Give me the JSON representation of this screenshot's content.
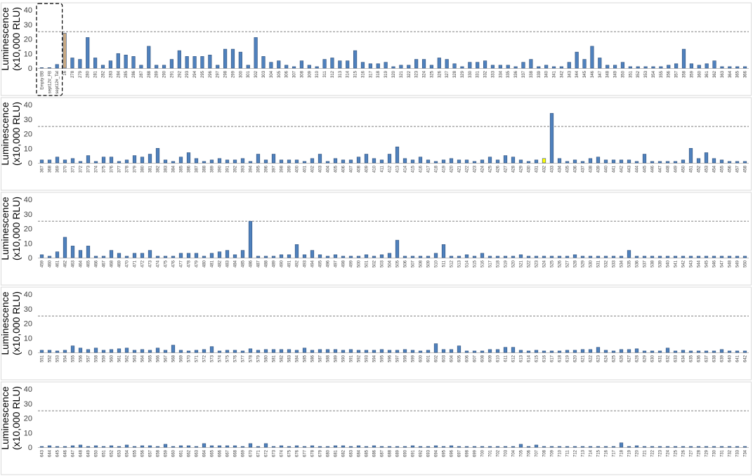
{
  "chart_data": [
    {
      "type": "bar",
      "ylabel": "Luminescence\n(x10,000 RLU)",
      "ylim": [
        0,
        40
      ],
      "yticks": [
        0,
        10,
        20,
        30,
        40
      ],
      "threshold": 25,
      "grid": false,
      "colors": {
        "default": "#4f81bd",
        "positive_control": "#c8a882",
        "hit": "#ffff00"
      },
      "highlight": {
        "category": "16",
        "color_key": "positive_control"
      },
      "boxed_controls": [
        "Empty BB",
        "sept12#_FB",
        "sept12#_Tat"
      ],
      "categories": [
        "Empty BB",
        "sept12#_FB",
        "sept12#_Tat",
        "16",
        "278",
        "279",
        "280",
        "281",
        "282",
        "283",
        "284",
        "285",
        "286",
        "287",
        "288",
        "289",
        "290",
        "291",
        "292",
        "293",
        "294",
        "295",
        "296",
        "297",
        "298",
        "299",
        "300",
        "301",
        "302",
        "303",
        "304",
        "305",
        "306",
        "307",
        "308",
        "309",
        "310",
        "311",
        "312",
        "313",
        "314",
        "315",
        "316",
        "317",
        "318",
        "319",
        "320",
        "321",
        "322",
        "323",
        "324",
        "325",
        "326",
        "327",
        "328",
        "329",
        "330",
        "331",
        "332",
        "333",
        "334",
        "335",
        "336",
        "337",
        "338",
        "339",
        "340",
        "341",
        "342",
        "343",
        "344",
        "345",
        "346",
        "347",
        "348",
        "349",
        "350",
        "351",
        "352",
        "353",
        "354",
        "355",
        "356",
        "357",
        "358",
        "359",
        "360",
        "361",
        "362",
        "363",
        "364",
        "365",
        "366"
      ],
      "values": [
        0.3,
        0.3,
        2.5,
        24,
        7,
        6,
        21,
        7,
        2,
        5,
        10,
        9,
        8,
        2,
        15,
        2,
        2,
        6,
        12,
        8,
        8,
        8,
        9,
        2,
        13,
        13,
        11,
        2,
        21,
        8,
        4,
        5,
        2,
        1,
        5,
        2,
        1,
        6,
        7,
        5,
        5,
        12,
        4,
        3,
        3,
        4,
        1,
        2,
        2,
        6,
        6,
        2,
        7,
        6,
        3,
        1,
        4,
        4,
        5,
        2,
        2,
        2,
        1,
        4,
        6,
        1,
        2,
        1,
        1,
        4,
        11,
        6,
        15,
        7,
        2,
        2,
        4,
        1,
        1,
        1,
        1,
        1,
        2,
        3,
        13,
        3,
        2,
        3,
        5,
        1,
        1,
        1,
        1,
        1
      ]
    },
    {
      "type": "bar",
      "ylabel": "Luminescence\n(x10,000 RLU)",
      "ylim": [
        0,
        40
      ],
      "yticks": [
        0,
        10,
        20,
        30,
        40
      ],
      "threshold": 25,
      "grid": false,
      "colors": {
        "default": "#4f81bd",
        "positive_control": "#c8a882",
        "hit": "#ffff00"
      },
      "highlight": {
        "category": "432",
        "color_key": "hit"
      },
      "categories": [
        "367",
        "368",
        "369",
        "370",
        "371",
        "372",
        "373",
        "374",
        "375",
        "376",
        "377",
        "378",
        "379",
        "380",
        "381",
        "382",
        "383",
        "384",
        "385",
        "386",
        "387",
        "388",
        "389",
        "390",
        "391",
        "392",
        "393",
        "394",
        "395",
        "396",
        "397",
        "398",
        "399",
        "400",
        "401",
        "402",
        "403",
        "404",
        "405",
        "406",
        "407",
        "408",
        "409",
        "410",
        "411",
        "412",
        "413",
        "414",
        "415",
        "416",
        "417",
        "418",
        "419",
        "420",
        "421",
        "422",
        "423",
        "424",
        "425",
        "426",
        "427",
        "428",
        "429",
        "430",
        "431",
        "432",
        "433",
        "434",
        "435",
        "436",
        "437",
        "438",
        "439",
        "440",
        "441",
        "442",
        "443",
        "444",
        "445",
        "446",
        "447",
        "448",
        "449",
        "450",
        "451",
        "452",
        "453",
        "454",
        "455",
        "456",
        "457",
        "458"
      ],
      "values": [
        2,
        2,
        4,
        2,
        3,
        1,
        5,
        1,
        4,
        4,
        1,
        2,
        5,
        4,
        6,
        10,
        2,
        1,
        4,
        7,
        3,
        1,
        2,
        3,
        2,
        2,
        3,
        1,
        6,
        2,
        6,
        2,
        2,
        2,
        1,
        3,
        6,
        1,
        3,
        2,
        2,
        4,
        6,
        3,
        2,
        6,
        11,
        3,
        2,
        4,
        2,
        1,
        2,
        3,
        2,
        2,
        1,
        2,
        4,
        2,
        5,
        4,
        2,
        1,
        2,
        3,
        34,
        3,
        1,
        2,
        1,
        3,
        4,
        2,
        2,
        2,
        2,
        1,
        6,
        1,
        1,
        1,
        1,
        2,
        10,
        3,
        7,
        3,
        2,
        1,
        1,
        1,
        3,
        2
      ]
    },
    {
      "type": "bar",
      "ylabel": "Luminescence\n(x10,000 RLU)",
      "ylim": [
        0,
        40
      ],
      "yticks": [
        0,
        10,
        20,
        30,
        40
      ],
      "threshold": 25,
      "grid": false,
      "colors": {
        "default": "#4f81bd",
        "positive_control": "#c8a882",
        "hit": "#ffff00"
      },
      "categories": [
        "459",
        "460",
        "461",
        "462",
        "463",
        "464",
        "465",
        "466",
        "467",
        "468",
        "469",
        "470",
        "471",
        "472",
        "473",
        "474",
        "475",
        "476",
        "477",
        "478",
        "479",
        "480",
        "481",
        "482",
        "483",
        "484",
        "485",
        "486",
        "487",
        "488",
        "489",
        "490",
        "491",
        "492",
        "493",
        "494",
        "495",
        "496",
        "497",
        "498",
        "499",
        "500",
        "501",
        "502",
        "503",
        "504",
        "505",
        "506",
        "507",
        "508",
        "509",
        "510",
        "511",
        "512",
        "513",
        "514",
        "515",
        "516",
        "517",
        "518",
        "519",
        "520",
        "521",
        "522",
        "523",
        "524",
        "525",
        "526",
        "527",
        "528",
        "529",
        "530",
        "531",
        "532",
        "533",
        "534",
        "535",
        "536",
        "537",
        "538",
        "539",
        "540",
        "541",
        "542",
        "543",
        "544",
        "545",
        "546",
        "547",
        "548",
        "549",
        "550"
      ],
      "values": [
        2,
        1,
        4,
        14,
        8,
        5,
        8,
        1,
        1,
        5,
        3,
        1,
        3,
        3,
        5,
        1,
        1,
        1,
        3,
        3,
        3,
        1,
        3,
        4,
        5,
        2,
        5,
        25,
        1,
        1,
        1,
        2,
        2,
        9,
        2,
        5,
        2,
        1,
        2,
        1,
        1,
        1,
        2,
        1,
        2,
        3,
        12,
        1,
        1,
        1,
        1,
        3,
        9,
        1,
        1,
        2,
        1,
        3,
        1,
        1,
        1,
        1,
        2,
        1,
        1,
        1,
        1,
        1,
        1,
        2,
        1,
        1,
        1,
        1,
        1,
        1,
        5,
        1,
        1,
        1,
        1,
        1,
        1,
        1,
        1,
        1,
        1,
        1,
        1,
        1,
        1,
        1
      ]
    },
    {
      "type": "bar",
      "ylabel": "Luminescence\n(x10,000 RLU)",
      "ylim": [
        0,
        40
      ],
      "yticks": [
        0,
        10,
        20,
        30,
        40
      ],
      "threshold": 25,
      "grid": false,
      "colors": {
        "default": "#4f81bd",
        "positive_control": "#c8a882",
        "hit": "#ffff00"
      },
      "categories": [
        "551",
        "552",
        "553",
        "554",
        "555",
        "556",
        "557",
        "558",
        "559",
        "560",
        "561",
        "562",
        "563",
        "564",
        "565",
        "566",
        "567",
        "568",
        "569",
        "570",
        "571",
        "572",
        "573",
        "574",
        "575",
        "576",
        "577",
        "578",
        "579",
        "580",
        "581",
        "582",
        "583",
        "584",
        "585",
        "586",
        "587",
        "588",
        "589",
        "590",
        "591",
        "592",
        "593",
        "594",
        "595",
        "596",
        "597",
        "598",
        "599",
        "600",
        "601",
        "602",
        "603",
        "604",
        "605",
        "606",
        "607",
        "608",
        "609",
        "610",
        "611",
        "612",
        "613",
        "614",
        "615",
        "616",
        "617",
        "618",
        "619",
        "620",
        "621",
        "622",
        "623",
        "624",
        "625",
        "626",
        "627",
        "628",
        "629",
        "630",
        "631",
        "632",
        "633",
        "634",
        "635",
        "636",
        "637",
        "638",
        "639",
        "640",
        "641",
        "642"
      ],
      "values": [
        1.5,
        1.5,
        1,
        1.5,
        4.5,
        3,
        2,
        3,
        1.5,
        2,
        2.5,
        3,
        1.5,
        2,
        1.5,
        3,
        1.5,
        5,
        1.5,
        1,
        1.5,
        2,
        4,
        1,
        1.5,
        1.5,
        1,
        2.5,
        1.5,
        2,
        2,
        2,
        2,
        1.5,
        3,
        1.5,
        2,
        2,
        2,
        1.5,
        2,
        1.5,
        1.5,
        1.5,
        2,
        1.5,
        1.5,
        2,
        1.5,
        1,
        1.5,
        6,
        2,
        2,
        4.5,
        1,
        1,
        1,
        2,
        2,
        3.5,
        3.5,
        1.5,
        1,
        1.5,
        1,
        1,
        1,
        1.5,
        1.5,
        2,
        2,
        3.5,
        1.5,
        1,
        2,
        2,
        2.5,
        1,
        1,
        1,
        3,
        1,
        1.5,
        1,
        1,
        1,
        1,
        2,
        1,
        1,
        1
      ]
    },
    {
      "type": "bar",
      "ylabel": "Luminescence\n(x10,000 RLU)",
      "ylim": [
        0,
        40
      ],
      "yticks": [
        0,
        10,
        20,
        30,
        40
      ],
      "threshold": 25,
      "grid": false,
      "colors": {
        "default": "#4f81bd",
        "positive_control": "#c8a882",
        "hit": "#ffff00"
      },
      "categories": [
        "643",
        "644",
        "645",
        "646",
        "647",
        "648",
        "649",
        "650",
        "651",
        "652",
        "653",
        "654",
        "655",
        "656",
        "657",
        "658",
        "659",
        "660",
        "661",
        "662",
        "663",
        "664",
        "665",
        "666",
        "667",
        "668",
        "669",
        "670",
        "671",
        "672",
        "673",
        "674",
        "675",
        "676",
        "677",
        "678",
        "679",
        "680",
        "681",
        "682",
        "683",
        "684",
        "685",
        "686",
        "687",
        "688",
        "689",
        "690",
        "691",
        "692",
        "693",
        "694",
        "695",
        "696",
        "697",
        "698",
        "699",
        "700",
        "701",
        "702",
        "703",
        "704",
        "705",
        "706",
        "707",
        "708",
        "709",
        "710",
        "711",
        "712",
        "713",
        "714",
        "715",
        "716",
        "717",
        "718",
        "719",
        "720",
        "721",
        "722",
        "723",
        "724",
        "725",
        "726",
        "727",
        "728",
        "729",
        "730",
        "731",
        "732",
        "733",
        "734"
      ],
      "values": [
        0.5,
        1,
        0.5,
        0.5,
        1,
        1.5,
        0.5,
        1,
        0.5,
        1,
        0.5,
        1.5,
        0.5,
        1,
        1,
        0.5,
        2,
        0.5,
        1,
        1,
        0.5,
        2.5,
        1,
        1,
        1,
        1,
        0.5,
        2.5,
        0.5,
        2.5,
        0.5,
        1,
        0.5,
        1,
        0.5,
        1,
        0.5,
        0.5,
        1,
        1,
        0.5,
        1,
        0.5,
        1,
        0.5,
        0.5,
        0.5,
        0.5,
        1,
        0.5,
        0.5,
        1,
        0.5,
        1,
        0.5,
        0.5,
        0.5,
        0.5,
        0.5,
        0.5,
        0.5,
        0.5,
        2,
        0.5,
        1.5,
        0.5,
        0.5,
        0.5,
        0.5,
        0.5,
        0.5,
        0.5,
        0.5,
        0.5,
        0.5,
        3,
        0.5,
        1,
        0.5,
        0.5,
        0.5,
        0.5,
        0.5,
        0.5,
        0.5,
        0.5,
        0.5,
        0.5,
        0.5,
        0.5,
        0.5,
        0.5
      ]
    }
  ]
}
